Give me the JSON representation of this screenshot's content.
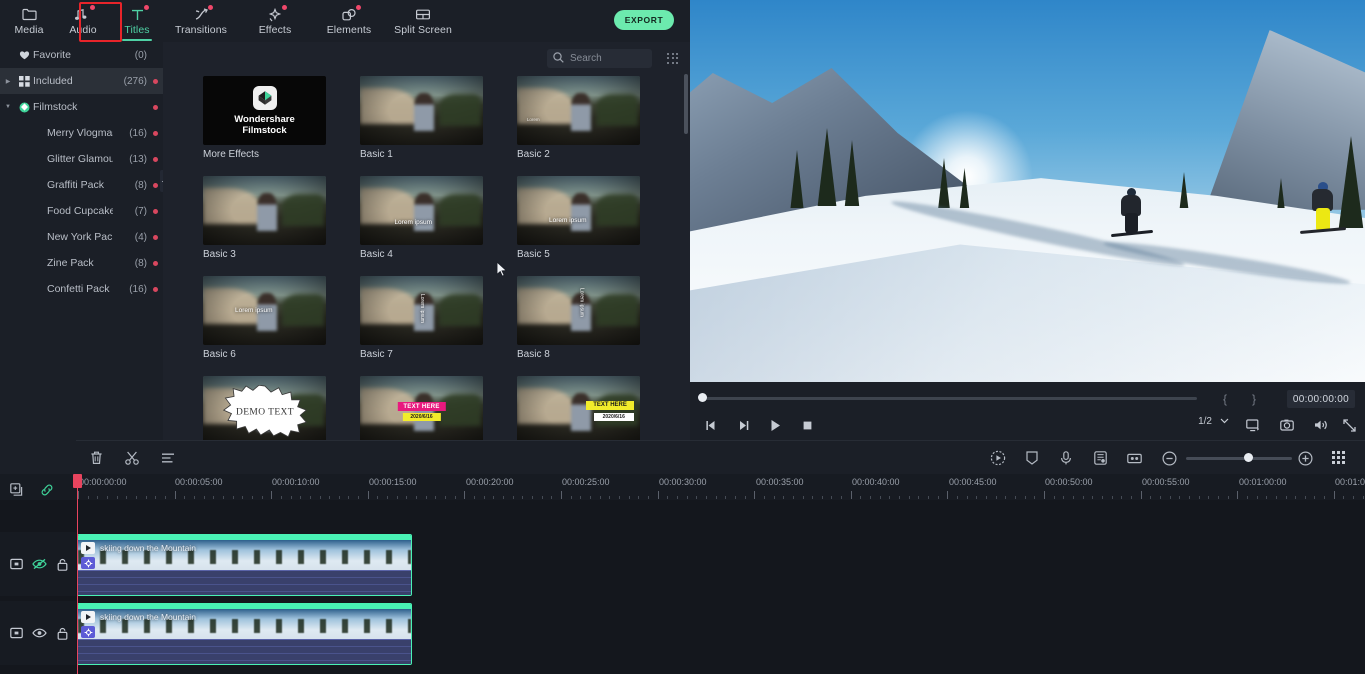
{
  "app": {
    "name": "Wondershare Filmora"
  },
  "topnav": {
    "items": [
      {
        "label": "Media",
        "icon": "folder-icon",
        "active": false,
        "badge": false
      },
      {
        "label": "Audio",
        "icon": "music-note-icon",
        "active": false,
        "badge": true
      },
      {
        "label": "Titles",
        "icon": "text-t-icon",
        "active": true,
        "badge": true
      },
      {
        "label": "Transitions",
        "icon": "transition-icon",
        "active": false,
        "badge": true
      },
      {
        "label": "Effects",
        "icon": "sparkle-icon",
        "active": false,
        "badge": true
      },
      {
        "label": "Elements",
        "icon": "shapes-icon",
        "active": false,
        "badge": true
      },
      {
        "label": "Split Screen",
        "icon": "split-screen-icon",
        "active": false,
        "badge": false
      }
    ],
    "export_label": "EXPORT",
    "export_color": "#6ceaae",
    "highlight_color": "#4fd1a5",
    "annotation_color": "#e8242a"
  },
  "sidebar": {
    "items": [
      {
        "label": "Favorite",
        "count": "(0)",
        "icon": "heart-icon",
        "level": 0,
        "twisty": "",
        "selected": false,
        "dot": false
      },
      {
        "label": "Included",
        "count": "(276)",
        "icon": "grid-icon",
        "level": 0,
        "twisty": "▶",
        "selected": true,
        "dot": true
      },
      {
        "label": "Filmstock",
        "count": "",
        "icon": "filmstock-icon",
        "level": 0,
        "twisty": "▼",
        "selected": false,
        "dot": true
      },
      {
        "label": "Merry Vlogmas…",
        "count": "(16)",
        "icon": "",
        "level": 1,
        "twisty": "",
        "selected": false,
        "dot": true
      },
      {
        "label": "Glitter Glamour…",
        "count": "(13)",
        "icon": "",
        "level": 1,
        "twisty": "",
        "selected": false,
        "dot": true
      },
      {
        "label": "Graffiti Pack",
        "count": "(8)",
        "icon": "",
        "level": 1,
        "twisty": "",
        "selected": false,
        "dot": true
      },
      {
        "label": "Food Cupcake P…",
        "count": "(7)",
        "icon": "",
        "level": 1,
        "twisty": "",
        "selected": false,
        "dot": true
      },
      {
        "label": "New York Pack",
        "count": "(4)",
        "icon": "",
        "level": 1,
        "twisty": "",
        "selected": false,
        "dot": true
      },
      {
        "label": "Zine Pack",
        "count": "(8)",
        "icon": "",
        "level": 1,
        "twisty": "",
        "selected": false,
        "dot": true
      },
      {
        "label": "Confetti Pack",
        "count": "(16)",
        "icon": "",
        "level": 1,
        "twisty": "",
        "selected": false,
        "dot": true
      }
    ]
  },
  "browser": {
    "search_placeholder": "Search",
    "search_value": "",
    "view_toggle_icon": "grid-view-icon",
    "items": [
      {
        "caption": "More Effects",
        "kind": "filmstock",
        "brand_line1": "Wondershare",
        "brand_line2": "Filmstock",
        "overlay": ""
      },
      {
        "caption": "Basic 1",
        "kind": "video",
        "overlay": ""
      },
      {
        "caption": "Basic 2",
        "kind": "video",
        "overlay": ""
      },
      {
        "caption": "Basic 3",
        "kind": "video",
        "overlay": ""
      },
      {
        "caption": "Basic 4",
        "kind": "video",
        "overlay": "Lorem ipsum"
      },
      {
        "caption": "Basic 5",
        "kind": "video",
        "overlay": "Lorem ipsum"
      },
      {
        "caption": "Basic 6",
        "kind": "video",
        "overlay": "Lorem ipsum"
      },
      {
        "caption": "Basic 7",
        "kind": "video",
        "overlay": "Lorem ipsum"
      },
      {
        "caption": "Basic 8",
        "kind": "video",
        "overlay": "Lorem ipsum"
      },
      {
        "caption": "",
        "kind": "demostar",
        "overlay": "DEMO TEXT"
      },
      {
        "caption": "",
        "kind": "pinkbadge",
        "overlay": "TEXT HERE",
        "sub": "2020/6/16"
      },
      {
        "caption": "",
        "kind": "yellowbadge",
        "overlay": "TEXT HERE",
        "sub": "2020/6/16"
      }
    ]
  },
  "player": {
    "timecode": "00:00:00:00",
    "speed": "1/2",
    "mark_in": "{",
    "mark_out": "}",
    "controls": [
      {
        "name": "prev-frame-button",
        "glyph": "prev"
      },
      {
        "name": "next-frame-button",
        "glyph": "next"
      },
      {
        "name": "play-button",
        "glyph": "play"
      },
      {
        "name": "stop-button",
        "glyph": "stop"
      }
    ],
    "right_icons": [
      {
        "name": "display-settings-icon"
      },
      {
        "name": "snapshot-icon"
      },
      {
        "name": "volume-icon"
      },
      {
        "name": "fullscreen-icon"
      }
    ]
  },
  "timeline": {
    "left_tools": [
      {
        "name": "undo-button",
        "glyph": "↶"
      },
      {
        "name": "redo-button",
        "glyph": "↷"
      },
      {
        "name": "delete-button",
        "glyph": "trash"
      },
      {
        "name": "split-button",
        "glyph": "scissors"
      },
      {
        "name": "mixer-button",
        "glyph": "sliders"
      }
    ],
    "right_tools": [
      {
        "name": "render-preview-button",
        "glyph": "render"
      },
      {
        "name": "marker-button",
        "glyph": "marker"
      },
      {
        "name": "voiceover-button",
        "glyph": "mic"
      },
      {
        "name": "audio-mixer-button",
        "glyph": "mixer"
      },
      {
        "name": "crop-button",
        "glyph": "crop"
      }
    ],
    "zoom_out_label": "−",
    "zoom_in_label": "+",
    "ruler_labels": [
      "00:00:00:00",
      "00:00:05:00",
      "00:00:10:00",
      "00:00:15:00",
      "00:00:20:00",
      "00:00:25:00",
      "00:00:30:00",
      "00:00:35:00",
      "00:00:40:00",
      "00:00:45:00",
      "00:00:50:00",
      "00:00:55:00",
      "00:01:00:00",
      "00:01:0"
    ],
    "playhead_position": "00:00:00:00",
    "tracks": [
      {
        "name": "track-1",
        "clip_label": "skiing down the Mountain",
        "visible": false,
        "locked": false
      },
      {
        "name": "track-2",
        "clip_label": "skiing down the Mountain",
        "visible": true,
        "locked": false
      }
    ],
    "clip_accent": "#49f2b5"
  }
}
